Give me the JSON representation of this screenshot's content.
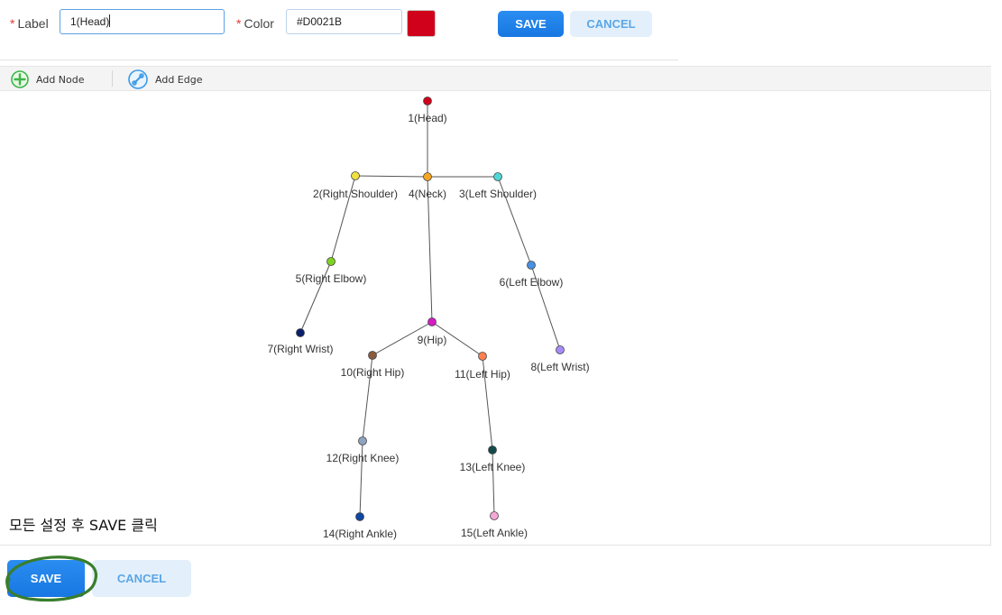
{
  "form": {
    "label_text": "Label",
    "label_value": "1(Head)",
    "color_text": "Color",
    "color_value": "#D0021B",
    "swatch_color": "#D0021B",
    "save": "SAVE",
    "cancel": "CANCEL"
  },
  "toolbar": {
    "add_node": "Add Node",
    "add_edge": "Add Edge"
  },
  "graph": {
    "nodes": [
      {
        "id": 1,
        "label": "1(Head)",
        "color": "#D0021B"
      },
      {
        "id": 2,
        "label": "2(Right Shoulder)",
        "color": "#F0E040"
      },
      {
        "id": 3,
        "label": "3(Left Shoulder)",
        "color": "#50D6D6"
      },
      {
        "id": 4,
        "label": "4(Neck)",
        "color": "#F5A623"
      },
      {
        "id": 5,
        "label": "5(Right Elbow)",
        "color": "#7ED321"
      },
      {
        "id": 6,
        "label": "6(Left Elbow)",
        "color": "#4A90E2"
      },
      {
        "id": 7,
        "label": "7(Right Wrist)",
        "color": "#0A1F6E"
      },
      {
        "id": 8,
        "label": "8(Left Wrist)",
        "color": "#A78BFA"
      },
      {
        "id": 9,
        "label": "9(Hip)",
        "color": "#D61BC4"
      },
      {
        "id": 10,
        "label": "10(Right Hip)",
        "color": "#8B5A3C"
      },
      {
        "id": 11,
        "label": "11(Left Hip)",
        "color": "#FF7F50"
      },
      {
        "id": 12,
        "label": "12(Right Knee)",
        "color": "#8FA4C0"
      },
      {
        "id": 13,
        "label": "13(Left Knee)",
        "color": "#124A4A"
      },
      {
        "id": 14,
        "label": "14(Right Ankle)",
        "color": "#0D47A1"
      },
      {
        "id": 15,
        "label": "15(Left Ankle)",
        "color": "#F4A6D7"
      }
    ],
    "edges": [
      [
        1,
        4
      ],
      [
        2,
        4
      ],
      [
        4,
        3
      ],
      [
        2,
        5
      ],
      [
        5,
        7
      ],
      [
        3,
        6
      ],
      [
        6,
        8
      ],
      [
        4,
        9
      ],
      [
        9,
        10
      ],
      [
        9,
        11
      ],
      [
        10,
        12
      ],
      [
        12,
        14
      ],
      [
        11,
        13
      ],
      [
        13,
        15
      ]
    ]
  },
  "instruction": "모든 설정 후 SAVE 클릭",
  "footer": {
    "save": "SAVE",
    "cancel": "CANCEL"
  }
}
